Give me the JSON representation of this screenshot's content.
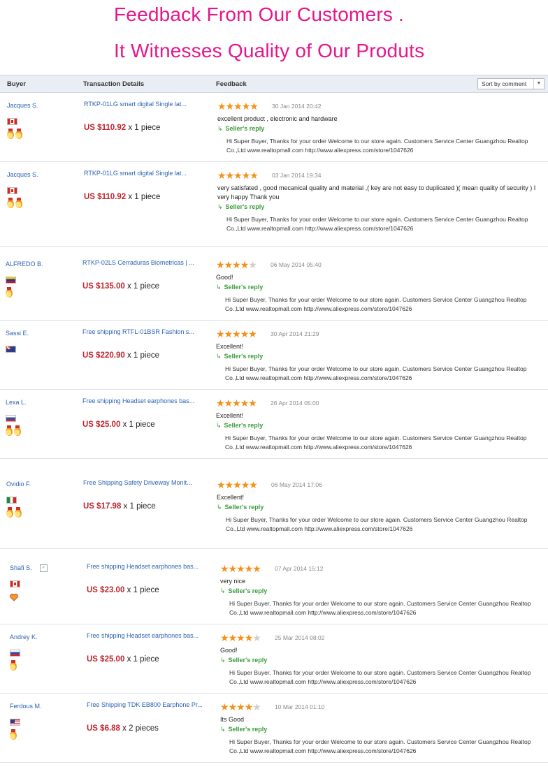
{
  "banner": {
    "line1": "Feedback From Our Customers .",
    "line2": "It Witnesses Quality of Our Produts"
  },
  "table": {
    "col_buyer": "Buyer",
    "col_transaction": "Transaction Details",
    "col_feedback": "Feedback",
    "sort_value": "Sort by comment",
    "sort_arrow_icon": "triangle-down-icon"
  },
  "reply_label": "Seller's reply",
  "reply_icon": "reply-arrow-icon",
  "colors": {
    "headline": "#e6168c",
    "price": "#c0262d",
    "link": "#2a62b4",
    "reply": "#3a9b3a",
    "star": "#f49016"
  },
  "rows": [
    {
      "buyer": "Jacques S.",
      "flag": "canada-flag-icon",
      "badges": [
        "medal-icon",
        "medal-icon"
      ],
      "product": "RTKP-01LG smart digital Single lat...",
      "price": "US $110.92",
      "qty": "x 1 piece",
      "rating": 5,
      "date": "30 Jan 2014 20:42",
      "comment": "excellent product , electronic and hardware",
      "reply": "Hi Super Buyer, Thanks for your order Welcome to our store again. Customers Service Center Guangzhou Realtop Co.,Ltd www.realtopmall.com http://www.aliexpress.com/store/1047626"
    },
    {
      "buyer": "Jacques S.",
      "flag": "canada-flag-icon",
      "badges": [
        "medal-icon",
        "medal-icon"
      ],
      "product": "RTKP-01LG smart digital Single lat...",
      "price": "US $110.92",
      "qty": "x 1 piece",
      "rating": 5,
      "date": "03 Jan 2014 19:34",
      "comment": "very satisfated , good mecanical quality and material ,( key are not easy to duplicated )( mean quality of security ) I very happy Thank you",
      "reply": "Hi Super Buyer, Thanks for your order Welcome to our store again. Customers Service Center Guangzhou Realtop Co.,Ltd www.realtopmall.com http://www.aliexpress.com/store/1047626"
    },
    {
      "buyer": "ALFREDO B.",
      "flag": "venezuela-flag-icon",
      "badges": [
        "medal-icon"
      ],
      "product": "RTKP-02LS Cerraduras Biometricas | ...",
      "price": "US $135.00",
      "qty": "x 1 piece",
      "rating": 4,
      "date": "06 May 2014 05:40",
      "comment": "Good!",
      "reply": "Hi Super Buyer, Thanks for your order Welcome to our store again. Customers Service Center Guangzhou Realtop Co.,Ltd www.realtopmall.com http://www.aliexpress.com/store/1047626"
    },
    {
      "buyer": "Sassi E.",
      "flag": "australia-flag-icon",
      "badges": [],
      "product": "Free shipping RTFL-01BSR Fashion s...",
      "price": "US $220.90",
      "qty": "x 1 piece",
      "rating": 5,
      "date": "30 Apr 2014 21:29",
      "comment": "Excellent!",
      "reply": "Hi Super Buyer, Thanks for your order Welcome to our store again. Customers Service Center Guangzhou Realtop Co.,Ltd www.realtopmall.com http://www.aliexpress.com/store/1047626"
    },
    {
      "buyer": "Lexa L.",
      "flag": "russia-flag-icon",
      "badges": [
        "medal-icon",
        "medal-icon"
      ],
      "product": "Free shipping Headset earphones bas...",
      "price": "US $25.00",
      "qty": "x 1 piece",
      "rating": 5,
      "date": "26 Apr 2014 05:00",
      "comment": "Excellent!",
      "reply": "Hi Super Buyer, Thanks for your order Welcome to our store again. Customers Service Center Guangzhou Realtop Co.,Ltd www.realtopmall.com http://www.aliexpress.com/store/1047626"
    },
    {
      "buyer": "Ovidio F.",
      "flag": "italy-flag-icon",
      "badges": [
        "medal-icon",
        "medal-icon"
      ],
      "product": "Free Shipping Safety Driveway Monit...",
      "price": "US $17.98",
      "qty": "x 1 piece",
      "rating": 5,
      "date": "06 May 2014 17:06",
      "comment": "Excellent!",
      "reply": "Hi Super Buyer, Thanks for your order Welcome to our store again. Customers Service Center Guangzhou Realtop Co.,Ltd www.realtopmall.com http://www.aliexpress.com/store/1047626"
    },
    {
      "buyer": "Shafi S.",
      "flag": "canada-flag-icon",
      "badges": [
        "heart-icon"
      ],
      "verified": true,
      "product": "Free shipping Headset earphones bas...",
      "price": "US $23.00",
      "qty": "x 1 piece",
      "rating": 5,
      "date": "07 Apr 2014 15:12",
      "comment": "very nice",
      "reply": "Hi Super Buyer, Thanks for your order Welcome to our store again. Customers Service Center Guangzhou Realtop Co.,Ltd www.realtopmall.com http://www.aliexpress.com/store/1047626"
    },
    {
      "buyer": "Andrey K.",
      "flag": "russia-flag-icon",
      "badges": [
        "medal-icon"
      ],
      "product": "Free shipping Headset earphones bas...",
      "price": "US $25.00",
      "qty": "x 1 piece",
      "rating": 4,
      "date": "25 Mar 2014 08:02",
      "comment": "Good!",
      "reply": "Hi Super Buyer, Thanks for your order Welcome to our store again. Customers Service Center Guangzhou Realtop Co.,Ltd www.realtopmall.com http://www.aliexpress.com/store/1047626"
    },
    {
      "buyer": "Ferdous M.",
      "flag": "usa-flag-icon",
      "badges": [
        "medal-icon"
      ],
      "product": "Free Shipping TDK EB800 Earphone Pr...",
      "price": "US $6.88",
      "qty": "x 2 pieces",
      "rating": 4,
      "date": "10 Mar 2014 01:10",
      "comment": "Its Good",
      "reply": "Hi Super Buyer, Thanks for your order Welcome to our store again. Customers Service Center Guangzhou Realtop Co.,Ltd www.realtopmall.com http://www.aliexpress.com/store/1047626"
    }
  ]
}
